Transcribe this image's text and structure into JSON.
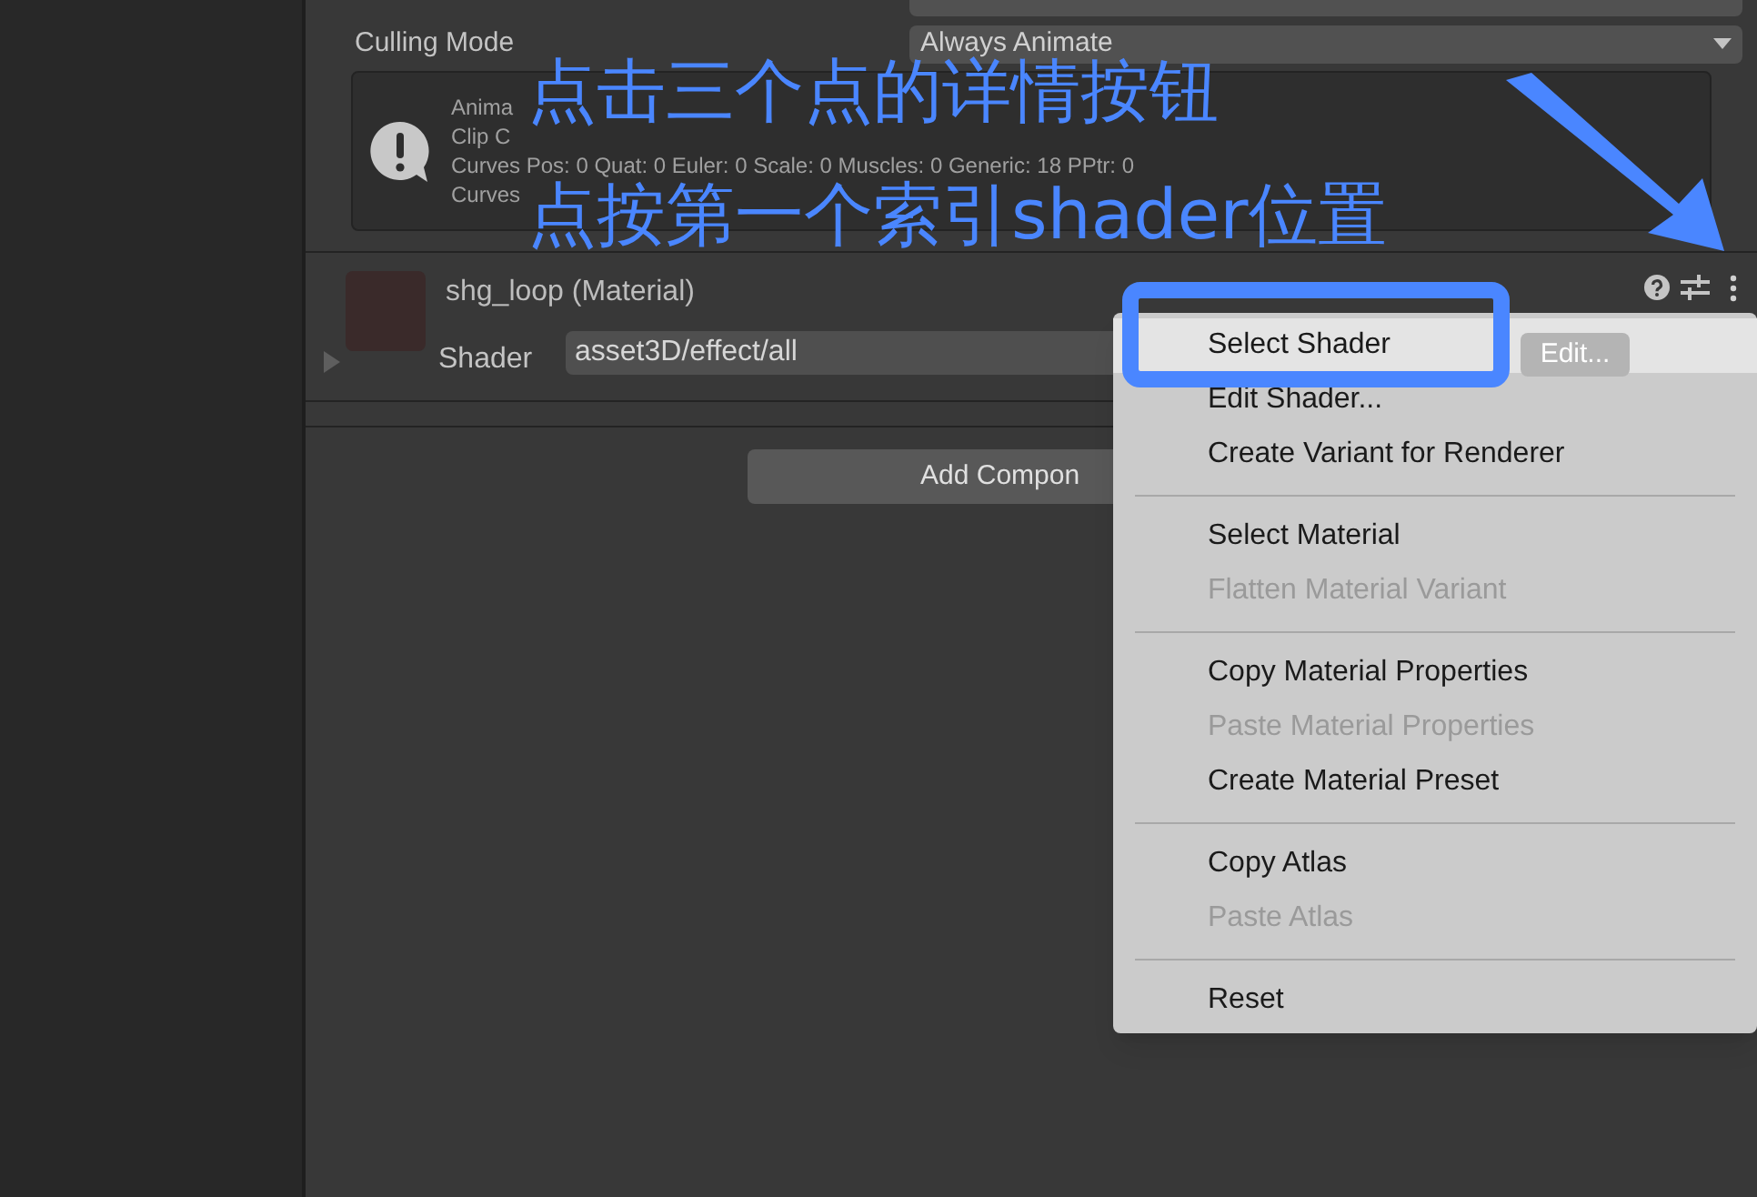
{
  "inspector": {
    "fields": [
      {
        "label": "Culling Mode",
        "value": "Always Animate"
      }
    ],
    "info_box": {
      "lines": [
        "Anima",
        "Clip C",
        "Curves Pos: 0 Quat: 0 Euler: 0 Scale: 0 Muscles: 0 Generic: 18 PPtr: 0",
        "Curves"
      ]
    },
    "material": {
      "title": "shg_loop (Material)",
      "expanded": false,
      "shader_label": "Shader",
      "shader_value": "asset3D/effect/all",
      "edit_button": "Edit..."
    },
    "add_component": "Add Compon"
  },
  "context_menu": {
    "groups": [
      [
        {
          "label": "Select Shader",
          "disabled": false,
          "highlighted": true
        },
        {
          "label": "Edit Shader...",
          "disabled": false,
          "highlighted": false
        },
        {
          "label": "Create Variant for Renderer",
          "disabled": false,
          "highlighted": false
        }
      ],
      [
        {
          "label": "Select Material",
          "disabled": false,
          "highlighted": false
        },
        {
          "label": "Flatten Material Variant",
          "disabled": true,
          "highlighted": false
        }
      ],
      [
        {
          "label": "Copy Material Properties",
          "disabled": false,
          "highlighted": false
        },
        {
          "label": "Paste Material Properties",
          "disabled": true,
          "highlighted": false
        },
        {
          "label": "Create Material Preset",
          "disabled": false,
          "highlighted": false
        }
      ],
      [
        {
          "label": "Copy Atlas",
          "disabled": false,
          "highlighted": false
        },
        {
          "label": "Paste Atlas",
          "disabled": true,
          "highlighted": false
        }
      ],
      [
        {
          "label": "Reset",
          "disabled": false,
          "highlighted": false
        }
      ]
    ]
  },
  "annotation": {
    "lines": [
      "点击三个点的详情按钮",
      "点按第一个索引shader位置"
    ]
  }
}
